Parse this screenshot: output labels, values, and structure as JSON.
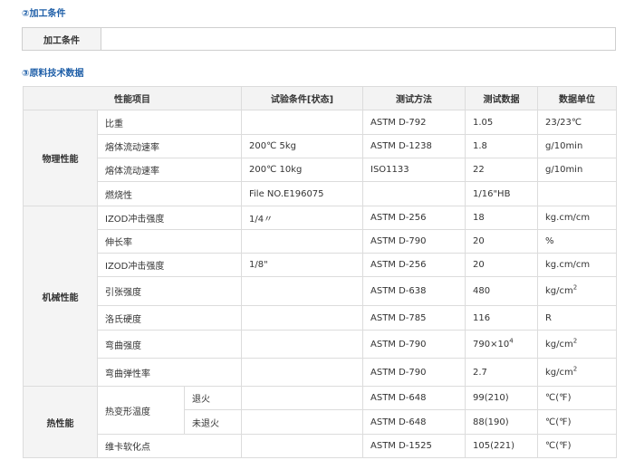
{
  "section2": {
    "title": "②加工条件",
    "row_label": "加工条件",
    "row_value": ""
  },
  "section3": {
    "title": "③原料技术数据",
    "headers": {
      "property": "性能项目",
      "condition": "试验条件[状态]",
      "method": "测试方法",
      "data": "测试数据",
      "unit": "数据单位"
    },
    "groups": {
      "physical": "物理性能",
      "mechanical": "机械性能",
      "thermal": "热性能"
    },
    "rows": [
      {
        "item": "比重",
        "condition": "",
        "method": "ASTM D-792",
        "value": "1.05",
        "unit": "23/23℃"
      },
      {
        "item": "熔体流动速率",
        "condition": "200℃ 5kg",
        "method": "ASTM D-1238",
        "value": "1.8",
        "unit": "g/10min"
      },
      {
        "item": "熔体流动速率",
        "condition": "200℃ 10kg",
        "method": "ISO1133",
        "value": "22",
        "unit": "g/10min"
      },
      {
        "item": "燃烧性",
        "condition": "File NO.E196075",
        "method": "",
        "value": "1/16\"HB",
        "unit": ""
      },
      {
        "item": "IZOD冲击强度",
        "condition": "1/4〃",
        "method": "ASTM D-256",
        "value": "18",
        "unit": "kg.cm/cm"
      },
      {
        "item": "伸长率",
        "condition": "",
        "method": "ASTM D-790",
        "value": "20",
        "unit": "%"
      },
      {
        "item": "IZOD冲击强度",
        "condition": "1/8\"",
        "method": "ASTM D-256",
        "value": "20",
        "unit": "kg.cm/cm"
      },
      {
        "item": "引张强度",
        "condition": "",
        "method": "ASTM D-638",
        "value": "480",
        "unit": "kg/cm",
        "unit_sup": "2"
      },
      {
        "item": "洛氏硬度",
        "condition": "",
        "method": "ASTM D-785",
        "value": "116",
        "unit": "R"
      },
      {
        "item": "弯曲强度",
        "condition": "",
        "method": "ASTM D-790",
        "value": "790×10",
        "value_sup": "4",
        "unit": "kg/cm",
        "unit_sup": "2"
      },
      {
        "item": "弯曲弹性率",
        "condition": "",
        "method": "ASTM D-790",
        "value": "2.7",
        "unit": "kg/cm",
        "unit_sup": "2"
      },
      {
        "item": "热变形温度",
        "sub": "退火",
        "condition": "",
        "method": "ASTM D-648",
        "value": "99(210)",
        "unit": "℃(℉)"
      },
      {
        "item": "热变形温度",
        "sub": "未退火",
        "condition": "",
        "method": "ASTM D-648",
        "value": "88(190)",
        "unit": "℃(℉)"
      },
      {
        "item": "维卡软化点",
        "condition": "",
        "method": "ASTM D-1525",
        "value": "105(221)",
        "unit": "℃(℉)"
      }
    ]
  }
}
